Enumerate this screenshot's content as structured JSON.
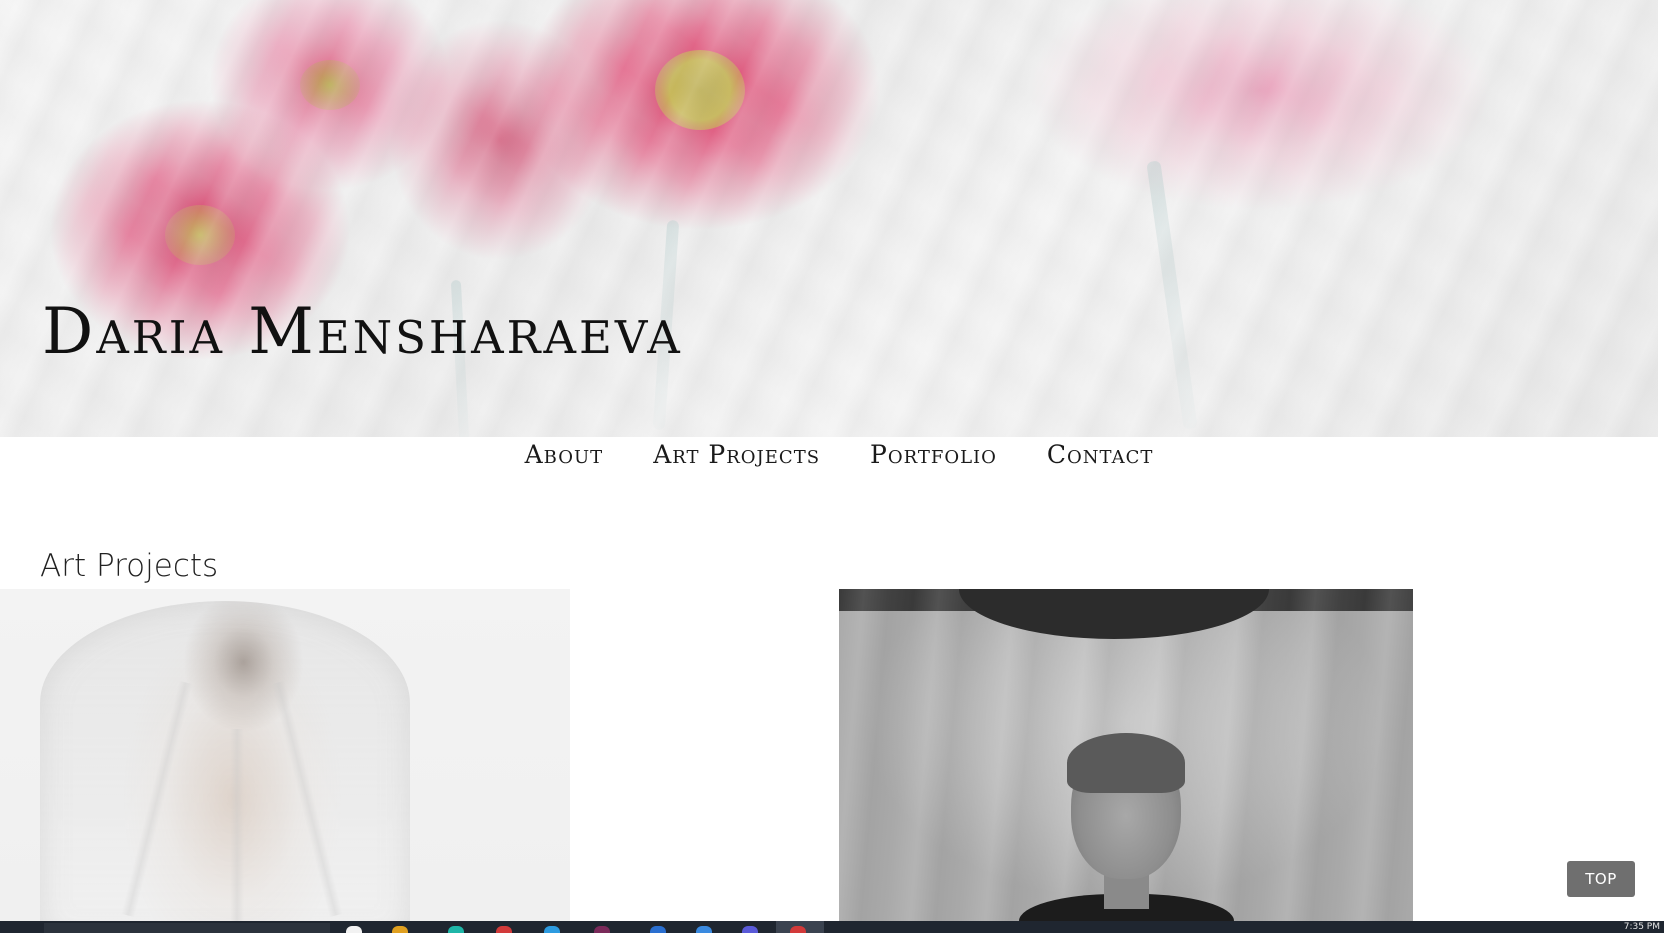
{
  "site": {
    "title": "Daria Mensharaeva"
  },
  "nav": {
    "items": [
      {
        "label": "About"
      },
      {
        "label": "Art Projects"
      },
      {
        "label": "Portfolio"
      },
      {
        "label": "Contact"
      }
    ]
  },
  "main": {
    "section_heading": "Art Projects"
  },
  "controls": {
    "top_button_label": "TOP"
  },
  "taskbar": {
    "clock": "7:35 PM"
  },
  "colors": {
    "title_text": "#111111",
    "top_button_bg": "#6f6f6f",
    "taskbar_bg": "#1f2630"
  }
}
